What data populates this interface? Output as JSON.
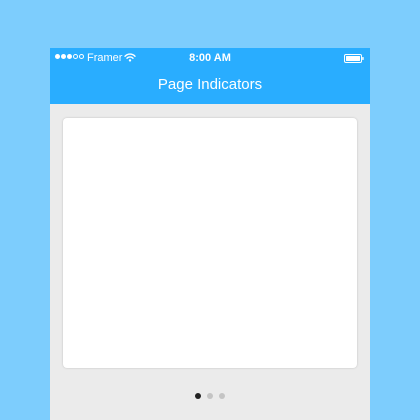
{
  "status_bar": {
    "carrier": "Framer",
    "time": "8:00 AM",
    "signal_bars_filled": 3,
    "signal_bars_total": 5
  },
  "nav_bar": {
    "title": "Page Indicators"
  },
  "pager": {
    "page_count": 3,
    "current_page": 1
  },
  "colors": {
    "background": "#7dcdfd",
    "accent": "#29adff",
    "screen": "#ebebeb",
    "card": "#ffffff",
    "indicator_active": "#222222",
    "indicator_inactive": "#c4c4c4"
  },
  "icons": {
    "signal": "signal-strength-dots",
    "wifi": "wifi-icon",
    "battery": "battery-icon"
  }
}
